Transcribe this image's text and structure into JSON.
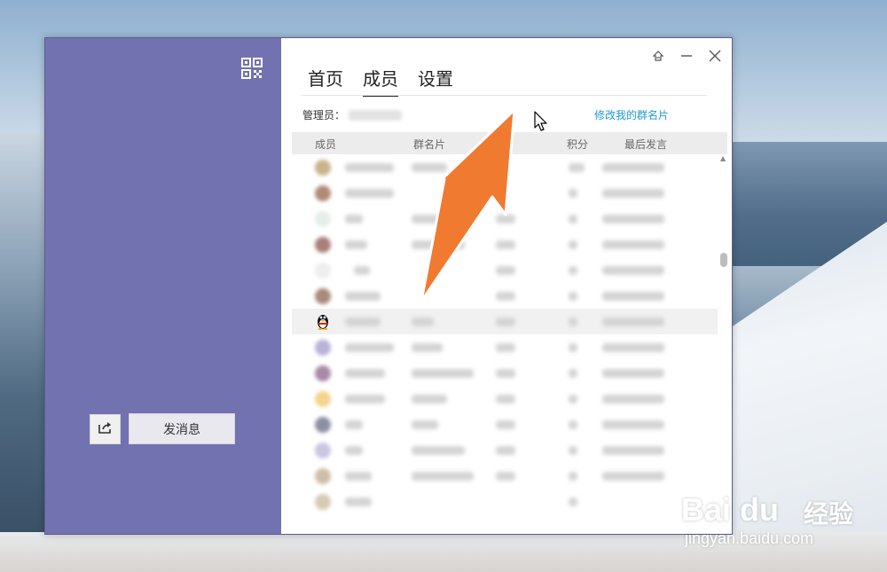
{
  "window": {
    "tabs": [
      {
        "label": "首页",
        "active": false
      },
      {
        "label": "成员",
        "active": true
      },
      {
        "label": "设置",
        "active": false
      }
    ],
    "admin_label": "管理员：",
    "edit_card_link": "修改我的群名片",
    "columns": [
      "成员",
      "群名片",
      "积分",
      "最后发言"
    ],
    "send_message_button": "发消息",
    "share_icon": "share-icon",
    "qr_icon": "qr-code-icon",
    "window_controls": [
      "pin-icon",
      "minimize-icon",
      "close-icon"
    ]
  },
  "colors": {
    "sidebar": "#7272b0",
    "link": "#1e9ad6",
    "annotation_arrow": "#f07a30"
  },
  "watermark": {
    "brand": "Bai du",
    "chinese": "经验",
    "url": "jingyan.baidu.com"
  }
}
